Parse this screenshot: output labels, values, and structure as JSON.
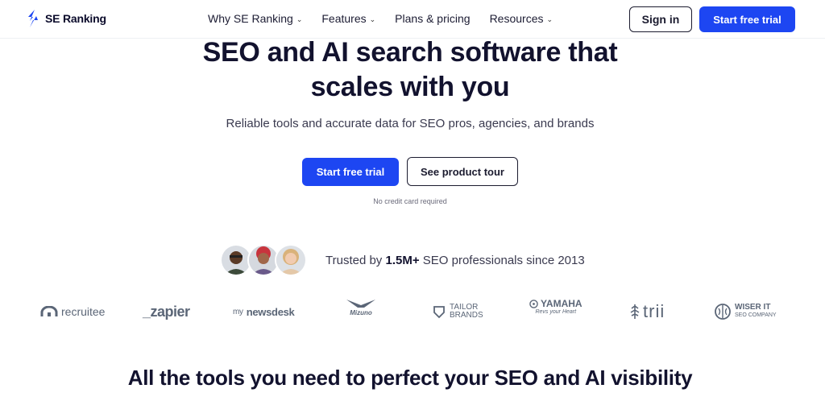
{
  "header": {
    "brand": "SE Ranking",
    "nav": [
      {
        "label": "Why SE Ranking",
        "has_dropdown": true
      },
      {
        "label": "Features",
        "has_dropdown": true
      },
      {
        "label": "Plans & pricing",
        "has_dropdown": false
      },
      {
        "label": "Resources",
        "has_dropdown": true
      }
    ],
    "signin_label": "Sign in",
    "trial_label": "Start free trial"
  },
  "hero": {
    "title_line1": "SEO and AI search software that",
    "title_line2": "scales with you",
    "subtitle": "Reliable tools and accurate data for SEO pros, agencies, and brands",
    "primary_cta": "Start free trial",
    "secondary_cta": "See product tour",
    "note": "No credit card required"
  },
  "trust": {
    "prefix": "Trusted by ",
    "count": "1.5M+",
    "suffix": " SEO professionals since 2013"
  },
  "logos": {
    "recruitee": "recruitee",
    "zapier": "_zapier",
    "newsdesk_prefix": "my",
    "newsdesk": "newsdesk",
    "mizuno": "Mizuno",
    "tailor_1": "TAILOR",
    "tailor_2": "BRANDS",
    "yamaha": "YAMAHA",
    "yamaha_tag": "Revs your Heart",
    "trii": "trii",
    "wiser_1": "WISER IT",
    "wiser_2": "SEO COMPANY"
  },
  "section": {
    "title": "All the tools you need to perfect your SEO and AI visibility"
  },
  "colors": {
    "accent": "#1d46f2",
    "text_dark": "#12122e",
    "logo_gray": "#5b6677"
  }
}
